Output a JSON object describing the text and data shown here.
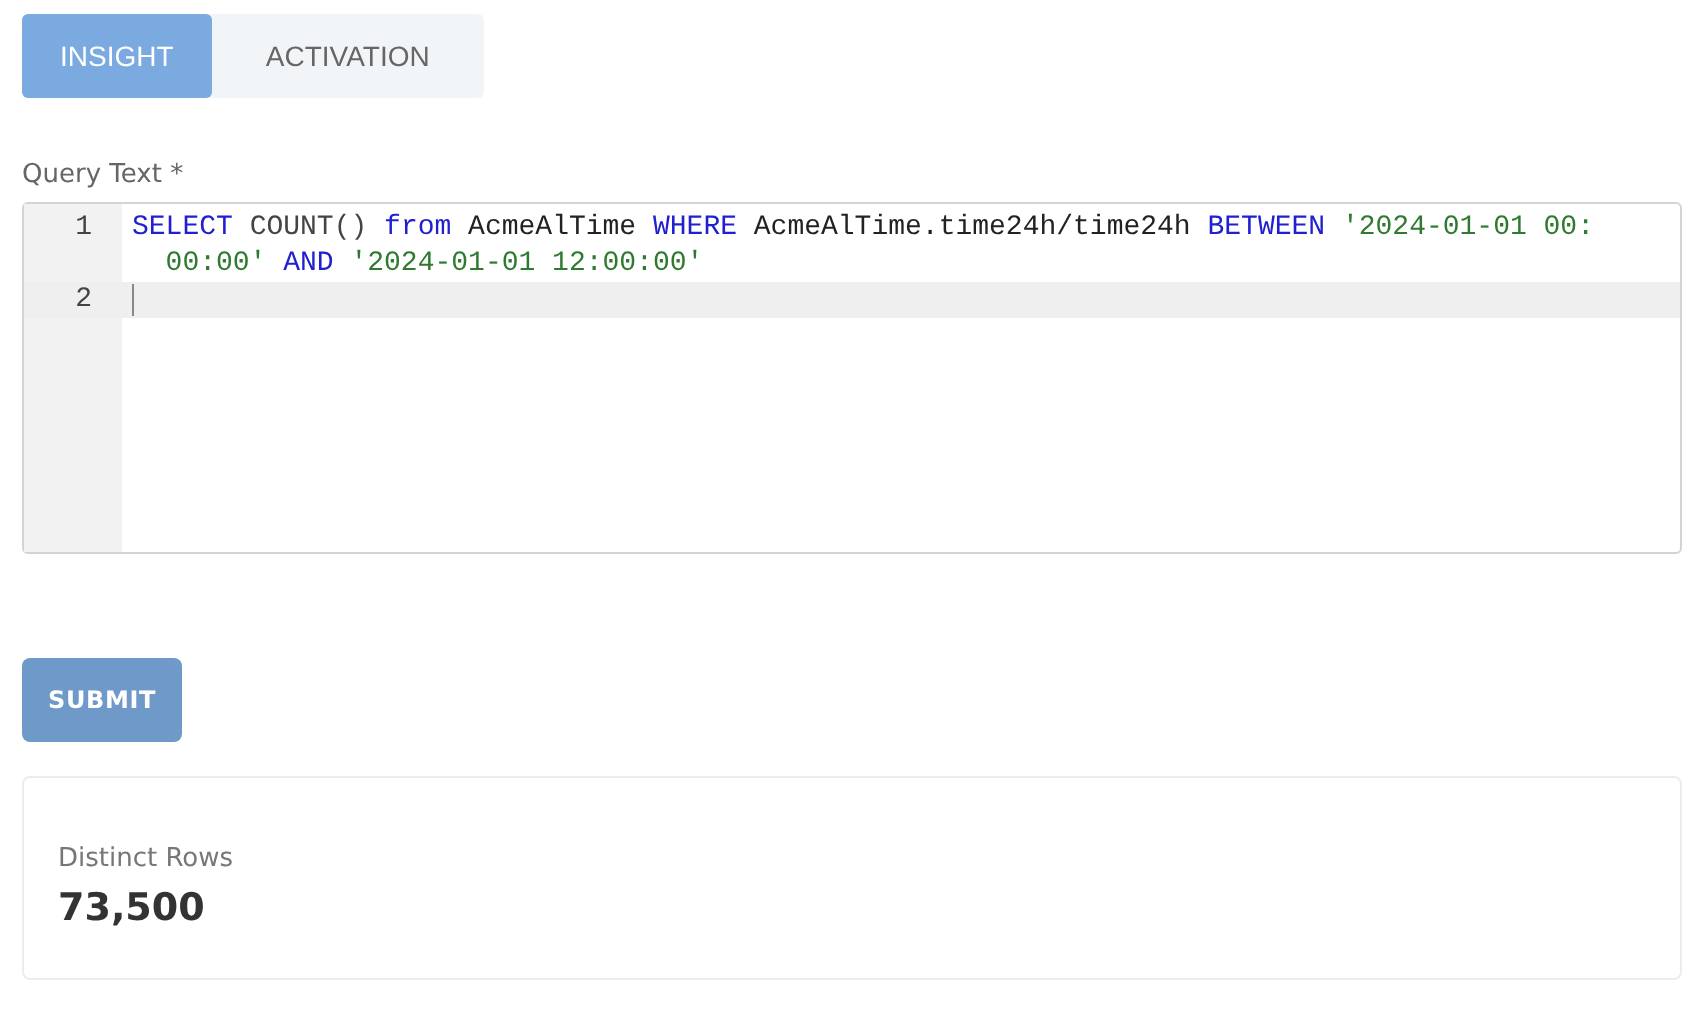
{
  "tabs": [
    {
      "label": "INSIGHT",
      "selected": true
    },
    {
      "label": "ACTIVATION",
      "selected": false
    }
  ],
  "query": {
    "label": "Query Text *",
    "lines": [
      {
        "number": "1",
        "active": false,
        "tokens": [
          {
            "kind": "keyword",
            "text": "SELECT"
          },
          {
            "kind": "function",
            "text": " COUNT() "
          },
          {
            "kind": "keyword",
            "text": "from"
          },
          {
            "kind": "plain",
            "text": " AcmeAlTime "
          },
          {
            "kind": "keyword",
            "text": "WHERE"
          },
          {
            "kind": "plain",
            "text": " AcmeAlTime.time24h/time24h "
          },
          {
            "kind": "keyword",
            "text": "BETWEEN"
          },
          {
            "kind": "string",
            "text": " '2024-01-01 00:00:00' "
          },
          {
            "kind": "keyword",
            "text": "AND"
          },
          {
            "kind": "string",
            "text": " '2024-01-01 12:00:00'"
          }
        ]
      },
      {
        "number": "2",
        "active": true
      }
    ]
  },
  "submit": {
    "label": "SUBMIT"
  },
  "result": {
    "label": "Distinct Rows",
    "value": "73,500"
  }
}
